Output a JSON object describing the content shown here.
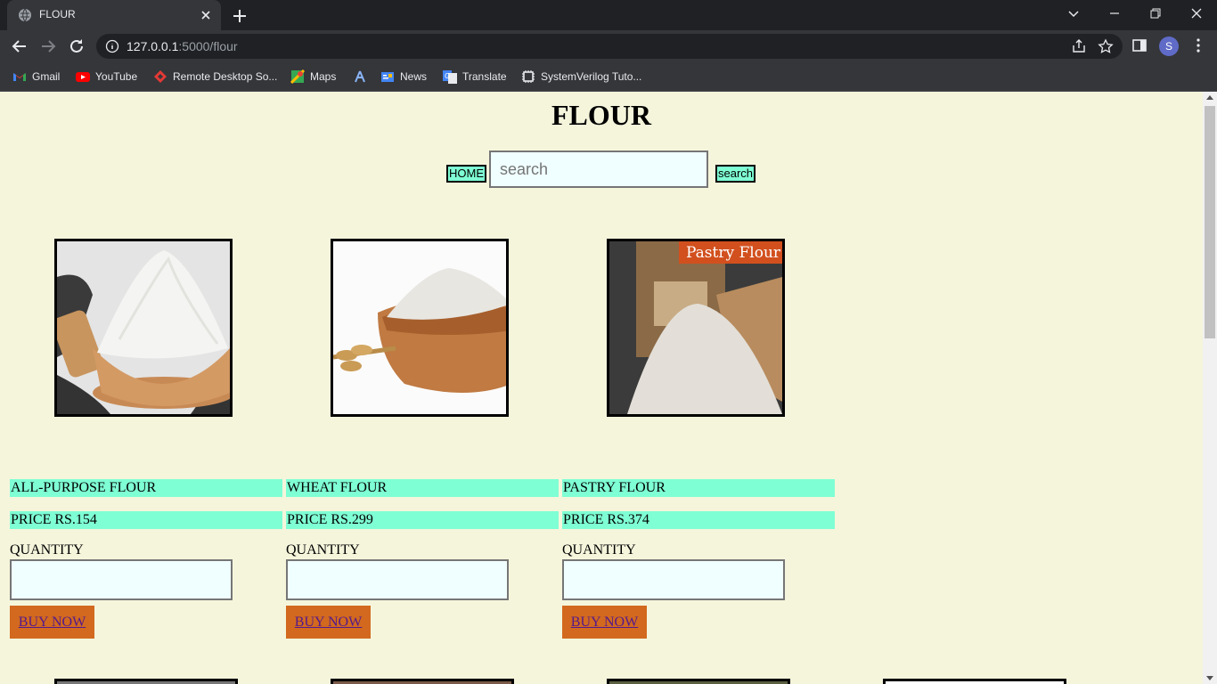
{
  "browser": {
    "tab_title": "FLOUR",
    "url_host": "127.0.0.1",
    "url_path": ":5000/flour",
    "avatar_letter": "S"
  },
  "bookmarks": [
    {
      "label": "Gmail",
      "icon": "gmail-icon"
    },
    {
      "label": "YouTube",
      "icon": "youtube-icon"
    },
    {
      "label": "Remote Desktop So...",
      "icon": "remote-desktop-icon"
    },
    {
      "label": "Maps",
      "icon": "maps-icon"
    },
    {
      "label": "",
      "icon": "bookmark-icon"
    },
    {
      "label": "News",
      "icon": "news-icon"
    },
    {
      "label": "Translate",
      "icon": "translate-icon"
    },
    {
      "label": "SystemVerilog Tuto...",
      "icon": "chip-icon"
    }
  ],
  "page": {
    "title": "FLOUR",
    "home_label": "HOME",
    "search_placeholder": "search",
    "search_label": "search",
    "quantity_label": "QUANTITY",
    "buy_label": "BUY NOW"
  },
  "products": [
    {
      "name": "ALL-PURPOSE FLOUR",
      "price": "PRICE RS.154",
      "image": "flour-bowl-image"
    },
    {
      "name": "WHEAT FLOUR",
      "price": "PRICE RS.299",
      "image": "wheat-flour-image"
    },
    {
      "name": "PASTRY FLOUR",
      "price": "PRICE RS.374",
      "image": "pastry-flour-image",
      "image_caption": "Pastry Flour"
    }
  ],
  "colors": {
    "page_bg": "#f5f5dc",
    "accent": "#7fffd4",
    "buy_button": "#d2691e",
    "input_bg": "#f0ffff"
  }
}
